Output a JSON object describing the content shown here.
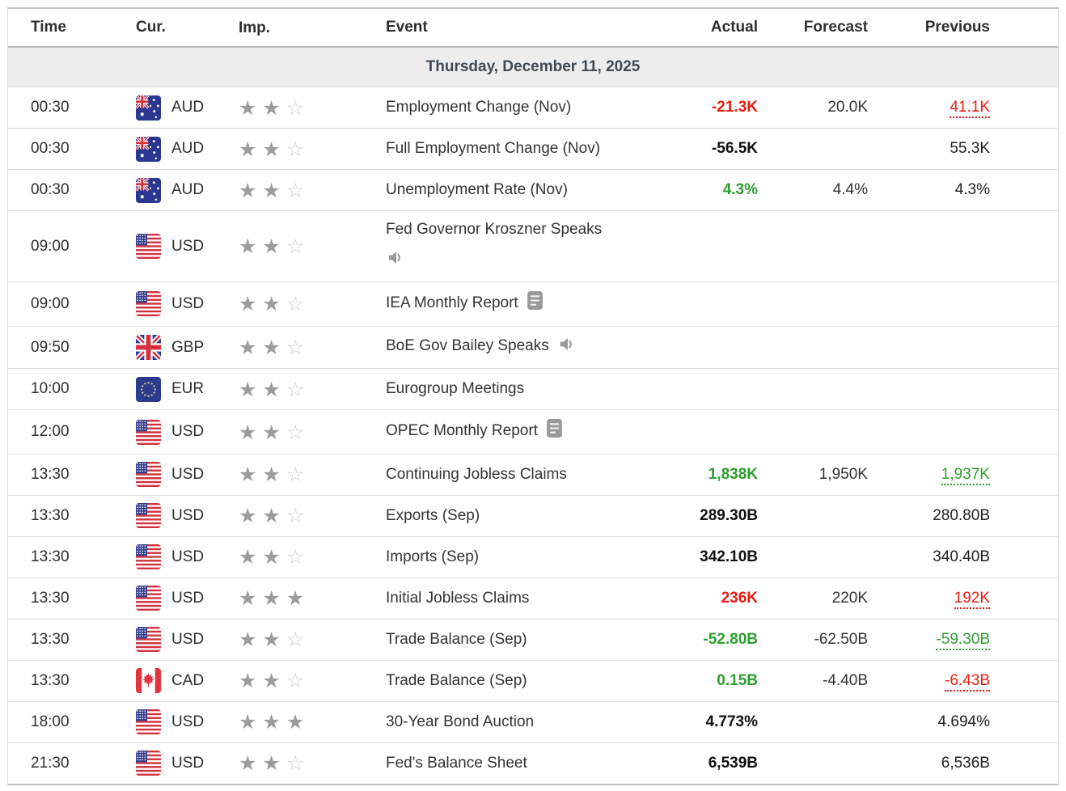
{
  "table": {
    "header": {
      "time": "Time",
      "cur": "Cur.",
      "imp": "Imp.",
      "event": "Event",
      "actual": "Actual",
      "forecast": "Forecast",
      "previous": "Previous"
    },
    "date_header": "Thursday, December 11, 2025",
    "rows": [
      {
        "time": "00:30",
        "currency": "AUD",
        "flag": "australia",
        "importance": 2,
        "importance_max": 3,
        "event": "Employment Change (Nov)",
        "event_icon": null,
        "icon_position": null,
        "actual": {
          "value": "-21.3K",
          "trend": "down"
        },
        "forecast": "20.0K",
        "previous": {
          "value": "41.1K",
          "trend": "down",
          "underlined": true
        }
      },
      {
        "time": "00:30",
        "currency": "AUD",
        "flag": "australia",
        "importance": 2,
        "importance_max": 3,
        "event": "Full Employment Change (Nov)",
        "event_icon": null,
        "icon_position": null,
        "actual": {
          "value": "-56.5K",
          "trend": "neutral"
        },
        "forecast": "",
        "previous": {
          "value": "55.3K",
          "trend": "neutral",
          "underlined": false
        }
      },
      {
        "time": "00:30",
        "currency": "AUD",
        "flag": "australia",
        "importance": 2,
        "importance_max": 3,
        "event": "Unemployment Rate (Nov)",
        "event_icon": null,
        "icon_position": null,
        "actual": {
          "value": "4.3%",
          "trend": "up"
        },
        "forecast": "4.4%",
        "previous": {
          "value": "4.3%",
          "trend": "neutral",
          "underlined": false
        }
      },
      {
        "time": "09:00",
        "currency": "USD",
        "flag": "united-states",
        "importance": 2,
        "importance_max": 3,
        "event": "Fed Governor Kroszner Speaks",
        "event_icon": "speaker",
        "icon_position": "below",
        "actual": {
          "value": "",
          "trend": "neutral"
        },
        "forecast": "",
        "previous": {
          "value": "",
          "trend": "neutral",
          "underlined": false
        }
      },
      {
        "time": "09:00",
        "currency": "USD",
        "flag": "united-states",
        "importance": 2,
        "importance_max": 3,
        "event": "IEA Monthly Report",
        "event_icon": "report",
        "icon_position": "inline",
        "actual": {
          "value": "",
          "trend": "neutral"
        },
        "forecast": "",
        "previous": {
          "value": "",
          "trend": "neutral",
          "underlined": false
        }
      },
      {
        "time": "09:50",
        "currency": "GBP",
        "flag": "united-kingdom",
        "importance": 2,
        "importance_max": 3,
        "event": "BoE Gov Bailey Speaks",
        "event_icon": "speaker",
        "icon_position": "inline",
        "actual": {
          "value": "",
          "trend": "neutral"
        },
        "forecast": "",
        "previous": {
          "value": "",
          "trend": "neutral",
          "underlined": false
        }
      },
      {
        "time": "10:00",
        "currency": "EUR",
        "flag": "european-union",
        "importance": 2,
        "importance_max": 3,
        "event": "Eurogroup Meetings",
        "event_icon": null,
        "icon_position": null,
        "actual": {
          "value": "",
          "trend": "neutral"
        },
        "forecast": "",
        "previous": {
          "value": "",
          "trend": "neutral",
          "underlined": false
        }
      },
      {
        "time": "12:00",
        "currency": "USD",
        "flag": "united-states",
        "importance": 2,
        "importance_max": 3,
        "event": "OPEC Monthly Report",
        "event_icon": "report",
        "icon_position": "inline",
        "actual": {
          "value": "",
          "trend": "neutral"
        },
        "forecast": "",
        "previous": {
          "value": "",
          "trend": "neutral",
          "underlined": false
        }
      },
      {
        "time": "13:30",
        "currency": "USD",
        "flag": "united-states",
        "importance": 2,
        "importance_max": 3,
        "event": "Continuing Jobless Claims",
        "event_icon": null,
        "icon_position": null,
        "actual": {
          "value": "1,838K",
          "trend": "up"
        },
        "forecast": "1,950K",
        "previous": {
          "value": "1,937K",
          "trend": "up",
          "underlined": true
        }
      },
      {
        "time": "13:30",
        "currency": "USD",
        "flag": "united-states",
        "importance": 2,
        "importance_max": 3,
        "event": "Exports (Sep)",
        "event_icon": null,
        "icon_position": null,
        "actual": {
          "value": "289.30B",
          "trend": "neutral"
        },
        "forecast": "",
        "previous": {
          "value": "280.80B",
          "trend": "neutral",
          "underlined": false
        }
      },
      {
        "time": "13:30",
        "currency": "USD",
        "flag": "united-states",
        "importance": 2,
        "importance_max": 3,
        "event": "Imports (Sep)",
        "event_icon": null,
        "icon_position": null,
        "actual": {
          "value": "342.10B",
          "trend": "neutral"
        },
        "forecast": "",
        "previous": {
          "value": "340.40B",
          "trend": "neutral",
          "underlined": false
        }
      },
      {
        "time": "13:30",
        "currency": "USD",
        "flag": "united-states",
        "importance": 3,
        "importance_max": 3,
        "event": "Initial Jobless Claims",
        "event_icon": null,
        "icon_position": null,
        "actual": {
          "value": "236K",
          "trend": "down"
        },
        "forecast": "220K",
        "previous": {
          "value": "192K",
          "trend": "down",
          "underlined": true
        }
      },
      {
        "time": "13:30",
        "currency": "USD",
        "flag": "united-states",
        "importance": 2,
        "importance_max": 3,
        "event": "Trade Balance (Sep)",
        "event_icon": null,
        "icon_position": null,
        "actual": {
          "value": "-52.80B",
          "trend": "up"
        },
        "forecast": "-62.50B",
        "previous": {
          "value": "-59.30B",
          "trend": "up",
          "underlined": true
        }
      },
      {
        "time": "13:30",
        "currency": "CAD",
        "flag": "canada",
        "importance": 2,
        "importance_max": 3,
        "event": "Trade Balance (Sep)",
        "event_icon": null,
        "icon_position": null,
        "actual": {
          "value": "0.15B",
          "trend": "up"
        },
        "forecast": "-4.40B",
        "previous": {
          "value": "-6.43B",
          "trend": "down",
          "underlined": true
        }
      },
      {
        "time": "18:00",
        "currency": "USD",
        "flag": "united-states",
        "importance": 3,
        "importance_max": 3,
        "event": "30-Year Bond Auction",
        "event_icon": null,
        "icon_position": null,
        "actual": {
          "value": "4.773%",
          "trend": "neutral"
        },
        "forecast": "",
        "previous": {
          "value": "4.694%",
          "trend": "neutral",
          "underlined": false
        }
      },
      {
        "time": "21:30",
        "currency": "USD",
        "flag": "united-states",
        "importance": 2,
        "importance_max": 3,
        "event": "Fed's Balance Sheet",
        "event_icon": null,
        "icon_position": null,
        "actual": {
          "value": "6,539B",
          "trend": "neutral"
        },
        "forecast": "",
        "previous": {
          "value": "6,536B",
          "trend": "neutral",
          "underlined": false
        }
      }
    ]
  },
  "colors": {
    "up": "#2e9e2e",
    "down": "#e81e14",
    "neutral_actual": "#111111",
    "neutral_previous": "#222222",
    "star_filled": "#9c9c9c",
    "star_empty": "#cfcfcf",
    "date_row_bg": "#ededed",
    "date_row_text": "#3f4a55"
  }
}
